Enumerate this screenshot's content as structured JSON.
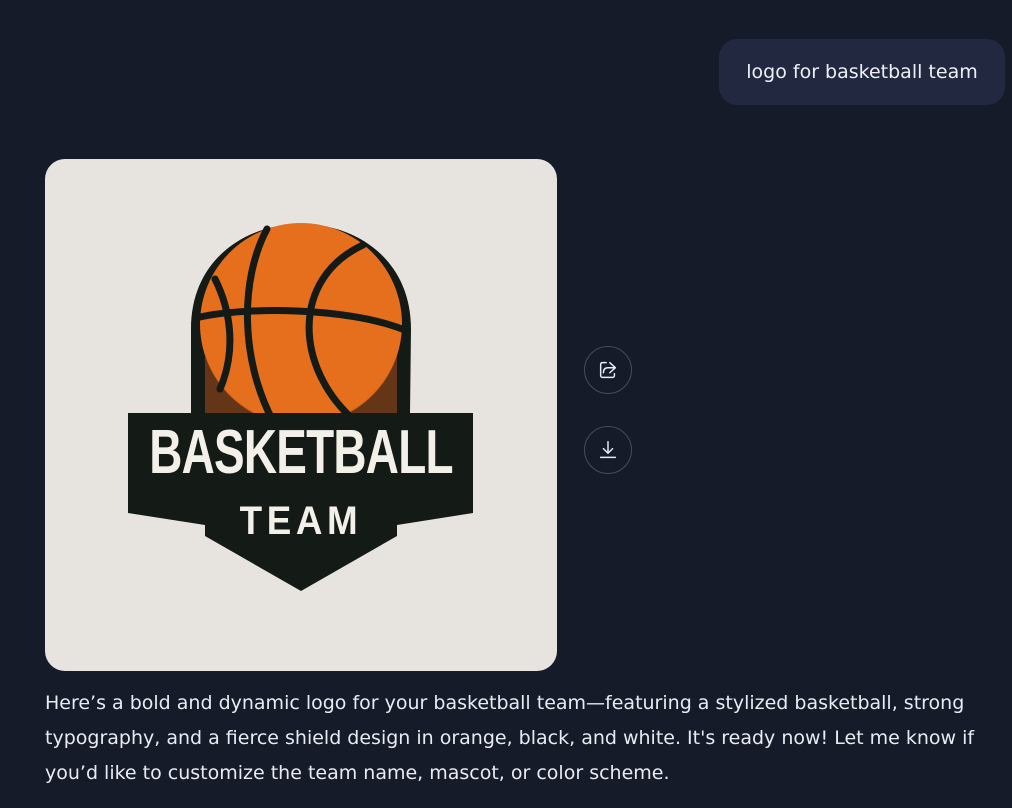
{
  "user_message": {
    "text": "logo for basketball team"
  },
  "generated_image": {
    "logo_title": "BASKETBALL",
    "logo_subtitle": "TEAM",
    "colors": {
      "background": "#e7e4df",
      "ball": "#e56f1c",
      "shield": "#141a16",
      "text": "#f2f0e9"
    }
  },
  "actions": {
    "share_icon": "share-icon",
    "download_icon": "download-icon"
  },
  "assistant_response": {
    "text": "Here’s a bold and dynamic logo for your basketball team—featuring a stylized basketball, strong typography, and a fierce shield design in orange, black, and white. It's ready now! Let me know if you’d like to customize the team name, mascot, or color scheme."
  },
  "theme": {
    "page_background": "#161b2a",
    "user_bubble_background": "#222840",
    "text_color": "#e9ebf2",
    "button_border": "#444c62"
  }
}
